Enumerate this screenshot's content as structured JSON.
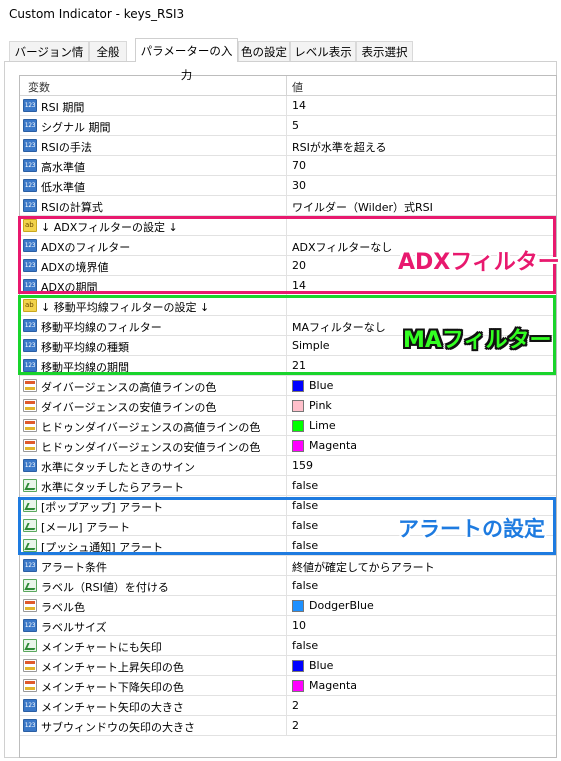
{
  "window": {
    "title": "Custom Indicator - keys_RSI3"
  },
  "tabs": [
    {
      "label": "バージョン情報",
      "active": false
    },
    {
      "label": "全般",
      "active": false
    },
    {
      "label": "パラメーターの入力",
      "active": true
    },
    {
      "label": "色の設定",
      "active": false
    },
    {
      "label": "レベル表示",
      "active": false
    },
    {
      "label": "表示選択",
      "active": false
    }
  ],
  "table": {
    "headers": {
      "variable": "変数",
      "value": "値"
    },
    "rows": [
      {
        "icon": "int-icon",
        "name": "RSI 期間",
        "value": "14"
      },
      {
        "icon": "int-icon",
        "name": "シグナル 期間",
        "value": "5"
      },
      {
        "icon": "int-icon",
        "name": "RSIの手法",
        "value": "RSIが水準を超える"
      },
      {
        "icon": "int-icon",
        "name": "高水準値",
        "value": "70"
      },
      {
        "icon": "int-icon",
        "name": "低水準値",
        "value": "30"
      },
      {
        "icon": "int-icon",
        "name": "RSIの計算式",
        "value": "ワイルダー（Wilder）式RSI"
      },
      {
        "icon": "string-icon",
        "name": "↓ ADXフィルターの設定 ↓",
        "value": ""
      },
      {
        "icon": "int-icon",
        "name": "ADXのフィルター",
        "value": "ADXフィルターなし"
      },
      {
        "icon": "int-icon",
        "name": "ADXの境界値",
        "value": "20"
      },
      {
        "icon": "int-icon",
        "name": "ADXの期間",
        "value": "14"
      },
      {
        "icon": "string-icon",
        "name": "↓ 移動平均線フィルターの設定 ↓",
        "value": ""
      },
      {
        "icon": "int-icon",
        "name": "移動平均線のフィルター",
        "value": "MAフィルターなし"
      },
      {
        "icon": "int-icon",
        "name": "移動平均線の種類",
        "value": "Simple"
      },
      {
        "icon": "int-icon",
        "name": "移動平均線の期間",
        "value": "21"
      },
      {
        "icon": "color-icon",
        "name": "ダイバージェンスの高値ラインの色",
        "value": "Blue",
        "swatch": "#0000ff"
      },
      {
        "icon": "color-icon",
        "name": "ダイバージェンスの安値ラインの色",
        "value": "Pink",
        "swatch": "#ffc0cb"
      },
      {
        "icon": "color-icon",
        "name": "ヒドゥンダイバージェンスの高値ラインの色",
        "value": "Lime",
        "swatch": "#00ff00"
      },
      {
        "icon": "color-icon",
        "name": "ヒドゥンダイバージェンスの安値ラインの色",
        "value": "Magenta",
        "swatch": "#ff00ff"
      },
      {
        "icon": "int-icon",
        "name": "水準にタッチしたときのサイン",
        "value": "159"
      },
      {
        "icon": "bool-icon",
        "name": "水準にタッチしたらアラート",
        "value": "false"
      },
      {
        "icon": "bool-icon",
        "name": "[ポップアップ] アラート",
        "value": "false"
      },
      {
        "icon": "bool-icon",
        "name": "[メール] アラート",
        "value": "false"
      },
      {
        "icon": "bool-icon",
        "name": "[プッシュ通知] アラート",
        "value": "false"
      },
      {
        "icon": "int-icon",
        "name": "アラート条件",
        "value": "終値が確定してからアラート"
      },
      {
        "icon": "bool-icon",
        "name": "ラベル（RSI値）を付ける",
        "value": "false"
      },
      {
        "icon": "color-icon",
        "name": "ラベル色",
        "value": "DodgerBlue",
        "swatch": "#1e90ff"
      },
      {
        "icon": "int-icon",
        "name": "ラベルサイズ",
        "value": "10"
      },
      {
        "icon": "bool-icon",
        "name": "メインチャートにも矢印",
        "value": "false"
      },
      {
        "icon": "color-icon",
        "name": "メインチャート上昇矢印の色",
        "value": "Blue",
        "swatch": "#0000ff"
      },
      {
        "icon": "color-icon",
        "name": "メインチャート下降矢印の色",
        "value": "Magenta",
        "swatch": "#ff00ff"
      },
      {
        "icon": "int-icon",
        "name": "メインチャート矢印の大きさ",
        "value": "2"
      },
      {
        "icon": "int-icon",
        "name": "サブウィンドウの矢印の大きさ",
        "value": "2"
      }
    ]
  },
  "annotations": {
    "adx": "ADXフィルター",
    "ma": "MAフィルター",
    "alert": "アラートの設定"
  },
  "colors": {
    "adx_box": "#e8196e",
    "ma_box": "#19d42c",
    "alert_box": "#1e7be0"
  }
}
